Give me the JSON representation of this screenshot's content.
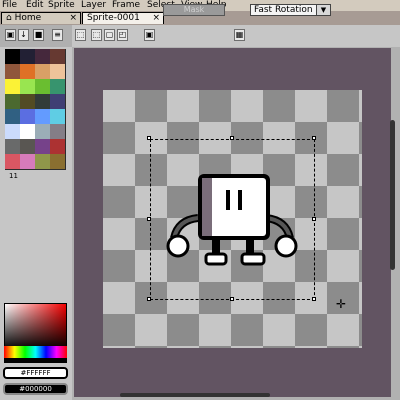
{
  "menu": [
    "File",
    "Edit",
    "Sprite",
    "Layer",
    "Frame",
    "Select",
    "View",
    "Help"
  ],
  "tabs": [
    {
      "label": "Home",
      "active": false,
      "close": "×"
    },
    {
      "label": "Sprite-0001",
      "active": true,
      "close": "×"
    }
  ],
  "toolbar": {
    "mask_label": "Mask",
    "rotation_select": "Fast Rotation",
    "buttons": [
      "lock",
      "down",
      "save",
      "list",
      "dashed-rect",
      "dashed-rect-2",
      "move",
      "select",
      "rotate",
      "brush"
    ]
  },
  "palette": [
    "#000000",
    "#222034",
    "#45283c",
    "#663931",
    "#8f563b",
    "#df7126",
    "#d9a066",
    "#eec39a",
    "#fbf236",
    "#99e550",
    "#6abe30",
    "#37946e",
    "#4b692f",
    "#524b24",
    "#323c39",
    "#3f3f74",
    "#306082",
    "#5b6ee1",
    "#639bff",
    "#5fcde4",
    "#cbdbfc",
    "#ffffff",
    "#9badb7",
    "#847e87",
    "#696a6a",
    "#595652",
    "#76428a",
    "#ac3232",
    "#d95763",
    "#d77bba",
    "#8f974a",
    "#8a6f30"
  ],
  "palette_index_label": "11",
  "foreground_color": "#FFFFFF",
  "background_color": "#000000"
}
